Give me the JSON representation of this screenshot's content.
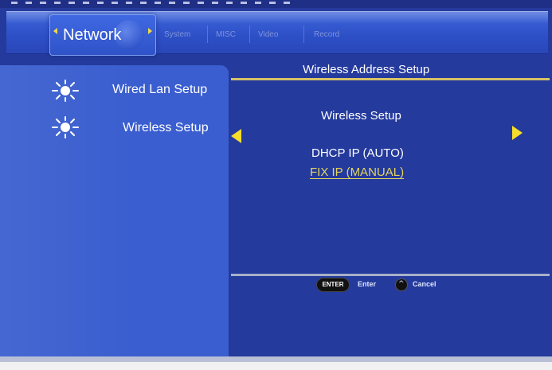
{
  "tabs": {
    "active": "Network",
    "items": [
      "System",
      "MISC",
      "Video",
      "Record"
    ]
  },
  "left_menu": {
    "items": [
      {
        "label": "Wired Lan Setup",
        "icon": "sun-icon"
      },
      {
        "label": "Wireless Setup",
        "icon": "sun-icon"
      }
    ]
  },
  "panel": {
    "title": "Wireless Address Setup",
    "section_label": "Wireless Setup",
    "options": [
      {
        "label": "DHCP IP (AUTO)",
        "selected": false
      },
      {
        "label": "FIX IP (MANUAL)",
        "selected": true
      }
    ]
  },
  "footer": {
    "enter_key": "ENTER",
    "enter_label": "Enter",
    "cancel_label": "Cancel"
  },
  "colors": {
    "background": "#243a9c",
    "left_panel": "#3a5ecf",
    "accent_yellow": "#f7dd2a",
    "selected_text": "#e4d45f",
    "divider_gold": "#d6c267"
  }
}
